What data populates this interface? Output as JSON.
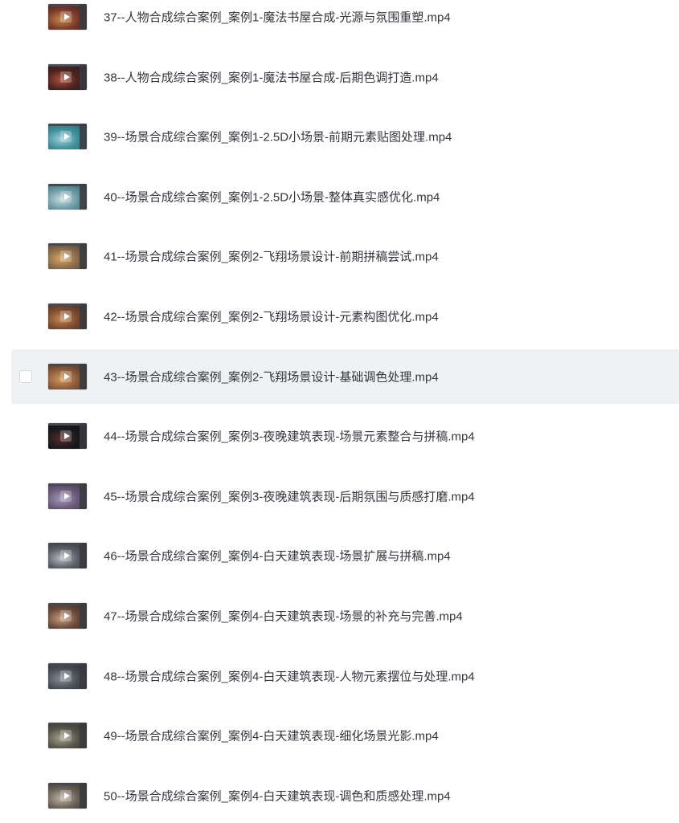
{
  "files": [
    {
      "name": "37--人物合成综合案例_案例1-魔法书屋合成-光源与氛围重塑.mp4",
      "thumb_icon": "video-thumbnail-icon",
      "selected": false,
      "thumb_colors": [
        "#7a3a2a",
        "#2b1d1a",
        "#c58a4a"
      ]
    },
    {
      "name": "38--人物合成综合案例_案例1-魔法书屋合成-后期色调打造.mp4",
      "thumb_icon": "video-thumbnail-icon",
      "selected": false,
      "thumb_colors": [
        "#4a2320",
        "#1f1a24",
        "#b0503a"
      ]
    },
    {
      "name": "39--场景合成综合案例_案例1-2.5D小场景-前期元素贴图处理.mp4",
      "thumb_icon": "video-thumbnail-icon",
      "selected": false,
      "thumb_colors": [
        "#3f8f9a",
        "#2d5d66",
        "#9fd0d8"
      ]
    },
    {
      "name": "40--场景合成综合案例_案例1-2.5D小场景-整体真实感优化.mp4",
      "thumb_icon": "video-thumbnail-icon",
      "selected": false,
      "thumb_colors": [
        "#6a9aa4",
        "#3b5a60",
        "#c9dcdf"
      ]
    },
    {
      "name": "41--场景合成综合案例_案例2-飞翔场景设计-前期拼稿尝试.mp4",
      "thumb_icon": "video-thumbnail-icon",
      "selected": false,
      "thumb_colors": [
        "#8a6a4a",
        "#3a3a3f",
        "#d9a86a"
      ]
    },
    {
      "name": "42--场景合成综合案例_案例2-飞翔场景设计-元素构图优化.mp4",
      "thumb_icon": "video-thumbnail-icon",
      "selected": false,
      "thumb_colors": [
        "#7a4a2f",
        "#2f2a2c",
        "#c48a54"
      ]
    },
    {
      "name": "43--场景合成综合案例_案例2-飞翔场景设计-基础调色处理.mp4",
      "thumb_icon": "video-thumbnail-icon",
      "selected": true,
      "thumb_colors": [
        "#8a5a3a",
        "#2e2b2d",
        "#d49a5c"
      ]
    },
    {
      "name": "44--场景合成综合案例_案例3-夜晚建筑表现-场景元素整合与拼稿.mp4",
      "thumb_icon": "video-thumbnail-icon",
      "selected": false,
      "thumb_colors": [
        "#1a1a1e",
        "#0e0e10",
        "#5a2a2a"
      ]
    },
    {
      "name": "45--场景合成综合案例_案例3-夜晚建筑表现-后期氛围与质感打磨.mp4",
      "thumb_icon": "video-thumbnail-icon",
      "selected": false,
      "thumb_colors": [
        "#6a5a7a",
        "#3a3448",
        "#a59ab8"
      ]
    },
    {
      "name": "46--场景合成综合案例_案例4-白天建筑表现-场景扩展与拼稿.mp4",
      "thumb_icon": "video-thumbnail-icon",
      "selected": false,
      "thumb_colors": [
        "#5a6068",
        "#2a2c30",
        "#b8bcc2"
      ]
    },
    {
      "name": "47--场景合成综合案例_案例4-白天建筑表现-场景的补充与完善.mp4",
      "thumb_icon": "video-thumbnail-icon",
      "selected": false,
      "thumb_colors": [
        "#6a4a3a",
        "#2d2a2a",
        "#c8a080"
      ]
    },
    {
      "name": "48--场景合成综合案例_案例4-白天建筑表现-人物元素摆位与处理.mp4",
      "thumb_icon": "video-thumbnail-icon",
      "selected": false,
      "thumb_colors": [
        "#4a5058",
        "#25272b",
        "#8a9098"
      ]
    },
    {
      "name": "49--场景合成综合案例_案例4-白天建筑表现-细化场景光影.mp4",
      "thumb_icon": "video-thumbnail-icon",
      "selected": false,
      "thumb_colors": [
        "#58564a",
        "#2a2a26",
        "#a8a490"
      ]
    },
    {
      "name": "50--场景合成综合案例_案例4-白天建筑表现-调色和质感处理.mp4",
      "thumb_icon": "video-thumbnail-icon",
      "selected": false,
      "thumb_colors": [
        "#6a6258",
        "#2c2a28",
        "#c0b4a4"
      ]
    }
  ]
}
